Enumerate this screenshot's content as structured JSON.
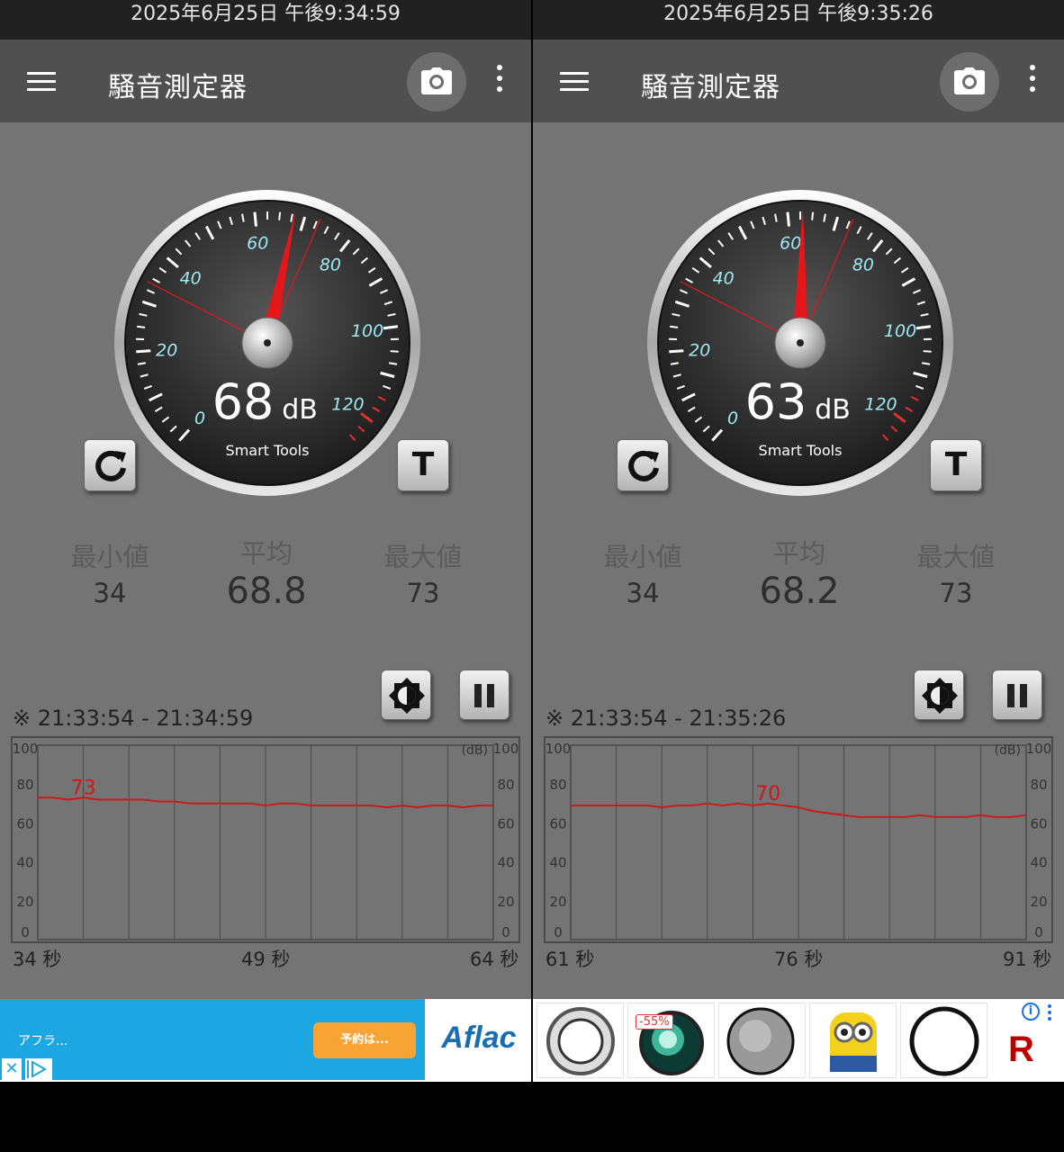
{
  "panels": [
    {
      "status_time": "2025年6月25日 午後9:34:59",
      "app_title": "騒音測定器",
      "current_db": "68",
      "db_unit": "dB",
      "brand": "Smart Tools",
      "gauge_labels": [
        "0",
        "20",
        "40",
        "60",
        "80",
        "100",
        "120"
      ],
      "needle_value": 68,
      "min_marker": 34,
      "max_marker": 73,
      "reset_label": "",
      "t_label": "T",
      "min_label": "最小値",
      "avg_label": "平均",
      "max_label": "最大値",
      "min_value": "34",
      "avg_value": "68.8",
      "max_value": "73",
      "range_text": "※ 21:33:54 - 21:34:59",
      "graph_unit": "(dB)",
      "graph_peak_label": "73",
      "x_labels": [
        "34 秒",
        "49 秒",
        "64 秒"
      ]
    },
    {
      "status_time": "2025年6月25日 午後9:35:26",
      "app_title": "騒音測定器",
      "current_db": "63",
      "db_unit": "dB",
      "brand": "Smart Tools",
      "gauge_labels": [
        "0",
        "20",
        "40",
        "60",
        "80",
        "100",
        "120"
      ],
      "needle_value": 63,
      "min_marker": 34,
      "max_marker": 73,
      "t_label": "T",
      "min_label": "最小値",
      "avg_label": "平均",
      "max_label": "最大値",
      "min_value": "34",
      "avg_value": "68.2",
      "max_value": "73",
      "range_text": "※ 21:33:54 - 21:35:26",
      "graph_unit": "(dB)",
      "graph_peak_label": "70",
      "x_labels": [
        "61 秒",
        "76 秒",
        "91 秒"
      ]
    }
  ],
  "graph_y_ticks": [
    "100",
    "80",
    "60",
    "40",
    "20",
    "0"
  ],
  "ads": {
    "aflac_text": "アフラ...",
    "aflac_cta": "予約は...",
    "aflac_brand": "Aflac",
    "close_symbol": "✕",
    "discount_badge": "-55%",
    "info_symbol": "i",
    "rakuten_logo": "R"
  },
  "colors": {
    "statusbar": "#212121",
    "appbar": "#505050",
    "background": "#747474",
    "needle": "#e3171a",
    "tick_label": "#9ee9f0",
    "graph_line": "#cc1a1a"
  },
  "chart_data": [
    {
      "type": "line",
      "title": "",
      "ylabel": "(dB)",
      "ylim": [
        0,
        100
      ],
      "xlim": [
        34,
        64
      ],
      "x_ticks": [
        "34 秒",
        "49 秒",
        "64 秒"
      ],
      "annotations": [
        {
          "text": "73",
          "x": 37,
          "y": 73
        }
      ],
      "series": [
        {
          "x": [
            34,
            35,
            36,
            37,
            38,
            39,
            40,
            41,
            42,
            43,
            44,
            45,
            46,
            47,
            48,
            49,
            50,
            51,
            52,
            53,
            54,
            55,
            56,
            57,
            58,
            59,
            60,
            61,
            62,
            63,
            64
          ],
          "values": [
            73,
            73,
            72,
            73,
            72,
            72,
            72,
            72,
            71,
            71,
            70,
            70,
            70,
            70,
            70,
            69,
            70,
            70,
            69,
            69,
            69,
            69,
            69,
            68,
            69,
            68,
            69,
            69,
            68,
            69,
            69
          ]
        }
      ]
    },
    {
      "type": "line",
      "title": "",
      "ylabel": "(dB)",
      "ylim": [
        0,
        100
      ],
      "xlim": [
        61,
        91
      ],
      "x_ticks": [
        "61 秒",
        "76 秒",
        "91 秒"
      ],
      "annotations": [
        {
          "text": "70",
          "x": 74,
          "y": 70
        }
      ],
      "series": [
        {
          "x": [
            61,
            62,
            63,
            64,
            65,
            66,
            67,
            68,
            69,
            70,
            71,
            72,
            73,
            74,
            75,
            76,
            77,
            78,
            79,
            80,
            81,
            82,
            83,
            84,
            85,
            86,
            87,
            88,
            89,
            90,
            91
          ],
          "values": [
            69,
            69,
            69,
            69,
            69,
            69,
            68,
            69,
            69,
            70,
            69,
            70,
            69,
            70,
            69,
            68,
            66,
            65,
            64,
            63,
            63,
            63,
            63,
            64,
            63,
            63,
            63,
            64,
            63,
            63,
            64
          ]
        }
      ]
    }
  ]
}
